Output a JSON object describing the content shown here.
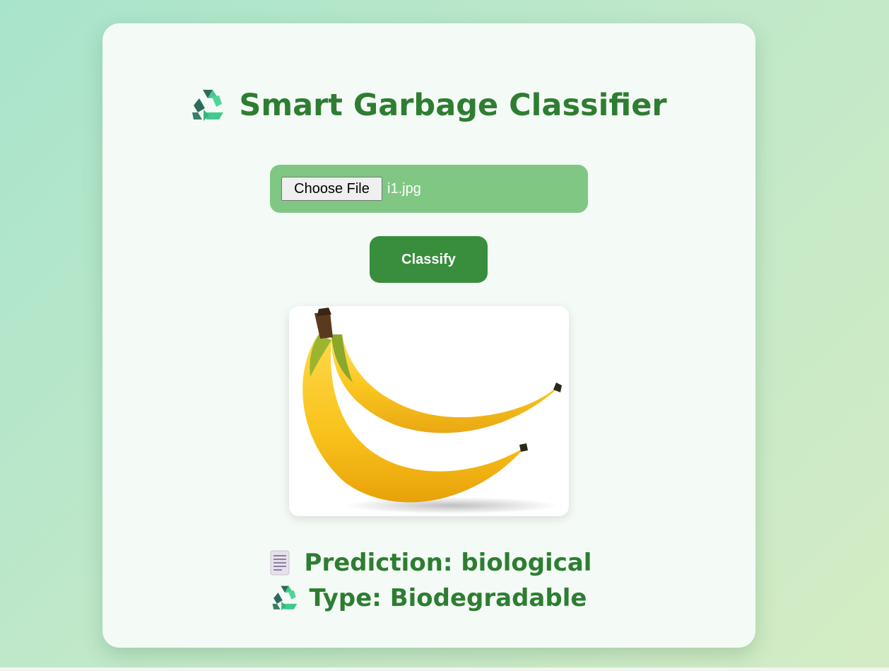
{
  "header": {
    "title": "Smart Garbage Classifier",
    "icon": "recycle-icon"
  },
  "upload": {
    "choose_label": "Choose File",
    "file_name": "i1.jpg"
  },
  "actions": {
    "classify_label": "Classify"
  },
  "preview": {
    "subject": "banana-image"
  },
  "result": {
    "prediction_label": "Prediction:",
    "prediction_value": "biological",
    "type_label": "Type:",
    "type_value": "Biodegradable",
    "prediction_icon": "receipt-icon",
    "type_icon": "recycle-icon"
  },
  "colors": {
    "title_green": "#2e7d32",
    "button_green": "#388e3c",
    "file_box_green": "#81c784",
    "card_bg": "#f4fbf6"
  }
}
